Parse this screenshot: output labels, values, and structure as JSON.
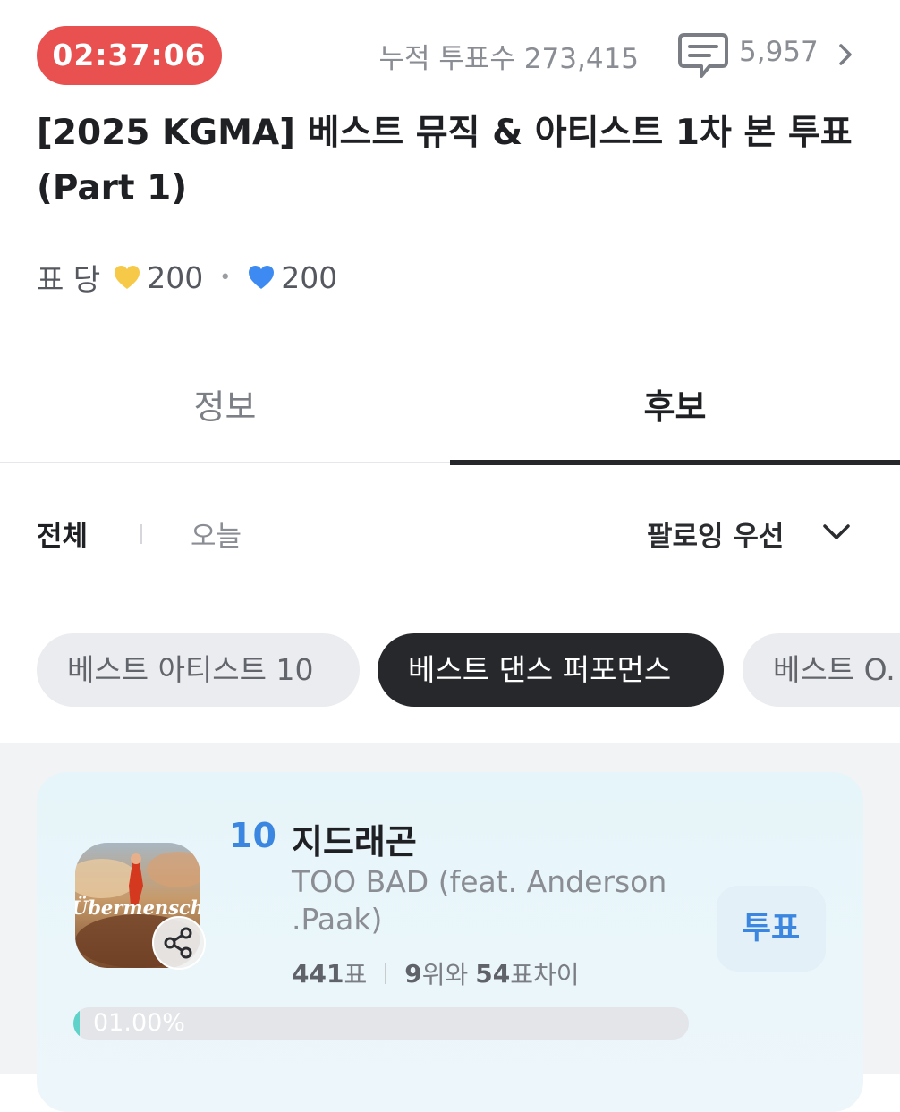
{
  "header": {
    "timer": "02:37:06",
    "total_votes": "누적 투표수 273,415",
    "comment_count": "5,957"
  },
  "title": "[2025 KGMA] 베스트 뮤직 & 아티스트 1차 본 투표 (Part 1)",
  "per_vote": {
    "label": "표 당",
    "yellow_hearts": "200",
    "separator": "•",
    "blue_hearts": "200"
  },
  "tabs": [
    {
      "label": "정보",
      "active": false
    },
    {
      "label": "후보",
      "active": true
    }
  ],
  "filters": {
    "all": "전체",
    "today": "오늘",
    "sort": "팔로잉 우선"
  },
  "categories": [
    {
      "label": "베스트 아티스트 10"
    },
    {
      "label": "베스트 댄스 퍼포먼스"
    },
    {
      "label": "베스트 O."
    }
  ],
  "candidate": {
    "rank": "10",
    "artist": "지드래곤",
    "song": "TOO BAD (feat. Anderson .Paak)",
    "album_text": "Übermensch",
    "votes": "441",
    "votes_suffix": "표",
    "gap_rank": "9",
    "gap_rank_suffix": "위와",
    "gap_votes": "54",
    "gap_votes_suffix": "표차이",
    "vote_button": "투표",
    "percent_label": "01.00%",
    "percent": 1.0
  },
  "colors": {
    "timer": "#e8514f",
    "accent_blue": "#3b86e0",
    "dark_chip": "#26282c",
    "progress_fill": "#5fd3c9"
  },
  "icons": [
    "comment-icon",
    "chevron-right-icon",
    "yellow-heart-icon",
    "blue-heart-icon",
    "chevron-down-icon",
    "share-icon"
  ]
}
